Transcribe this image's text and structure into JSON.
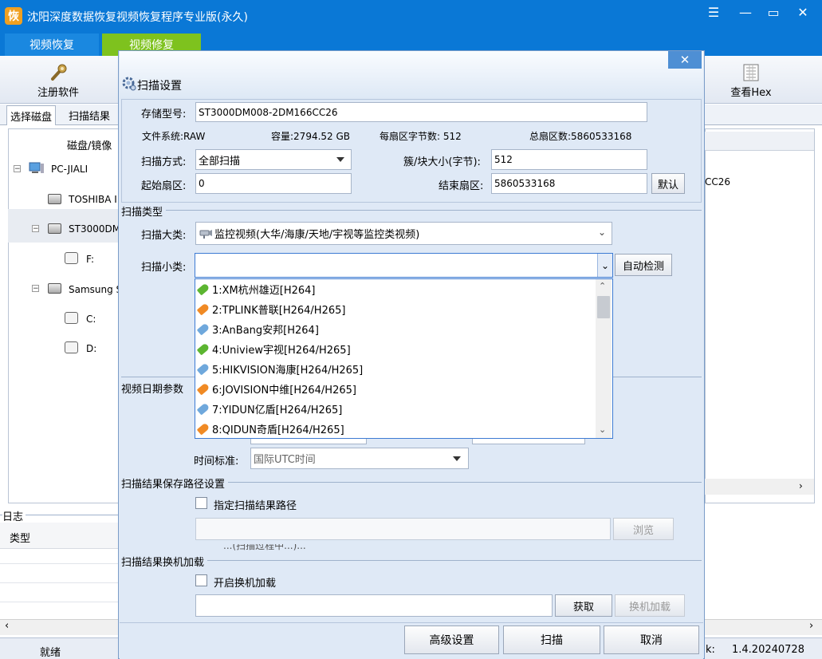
{
  "app": {
    "title": "沈阳深度数据恢复视频恢复程序专业版(永久)",
    "window_buttons": [
      "☰",
      "—",
      "▭",
      "✕"
    ]
  },
  "main_tabs": [
    {
      "label": "视频恢复",
      "active": false
    },
    {
      "label": "视频修复",
      "active": true
    }
  ],
  "toolbar": {
    "register_label": "注册软件",
    "view_hex_label": "查看Hex"
  },
  "subtabs": [
    "选择磁盘",
    "扫描结果"
  ],
  "tree": {
    "header": "磁盘/镜像",
    "items": [
      {
        "label": "PC-JIALI"
      },
      {
        "label": "TOSHIBA I"
      },
      {
        "label": "ST3000DM"
      },
      {
        "label": "F:"
      },
      {
        "label": "Samsung S"
      },
      {
        "label": "C:"
      },
      {
        "label": "D:"
      }
    ],
    "right_value": "CC26"
  },
  "log": {
    "title": "日志",
    "column": "类型"
  },
  "status": {
    "state": "就绪",
    "version_label": "k:",
    "version": "1.4.20240728"
  },
  "dialog": {
    "title": "扫描设置",
    "close": "✕",
    "storage_model_label": "存储型号:",
    "storage_model": "ST3000DM008-2DM166CC26",
    "fs_label": "文件系统:RAW",
    "capacity_label": "容量:2794.52 GB",
    "bytes_per_sector_label": "每扇区字节数: 512",
    "total_sectors_label": "总扇区数:5860533168",
    "scan_mode_label": "扫描方式:",
    "scan_mode": "全部扫描",
    "cluster_size_label": "簇/块大小(字节):",
    "cluster_size": "512",
    "start_sector_label": "起始扇区:",
    "start_sector": "0",
    "end_sector_label": "结束扇区:",
    "end_sector": "5860533168",
    "default_btn": "默认",
    "scan_type_group": "扫描类型",
    "category_label": "扫描大类:",
    "category": "监控视频(大华/海康/天地/宇视等监控类视频)",
    "subcategory_label": "扫描小类:",
    "subcategory": "",
    "auto_detect_btn": "自动检测",
    "date_group": "视频日期参数",
    "time_std_label": "时间标准:",
    "time_std": "国际UTC时间",
    "save_path_group": "扫描结果保存路径设置",
    "specify_path_label": "指定扫描结果路径",
    "browse_btn": "浏览",
    "hidden_note": "...(扫描过程中...)...",
    "reload_group": "扫描结果换机加载",
    "enable_reload_label": "开启换机加载",
    "fetch_btn": "获取",
    "reload_btn": "换机加载",
    "advanced_btn": "高级设置",
    "scan_btn": "扫描",
    "cancel_btn": "取消"
  },
  "dropdown": {
    "items": [
      {
        "label": "1:XM杭州雄迈[H264]",
        "color": "#5cb531"
      },
      {
        "label": "2:TPLINK普联[H264/H265]",
        "color": "#f08a24"
      },
      {
        "label": "3:AnBang安邦[H264]",
        "color": "#6fa8dc"
      },
      {
        "label": "4:Uniview宇视[H264/H265]",
        "color": "#5cb531"
      },
      {
        "label": "5:HIKVISION海康[H264/H265]",
        "color": "#6fa8dc"
      },
      {
        "label": "6:JOVISION中维[H264/H265]",
        "color": "#f08a24"
      },
      {
        "label": "7:YIDUN亿盾[H264/H265]",
        "color": "#6fa8dc"
      },
      {
        "label": "8:QIDUN奇盾[H264/H265]",
        "color": "#f08a24"
      }
    ]
  }
}
